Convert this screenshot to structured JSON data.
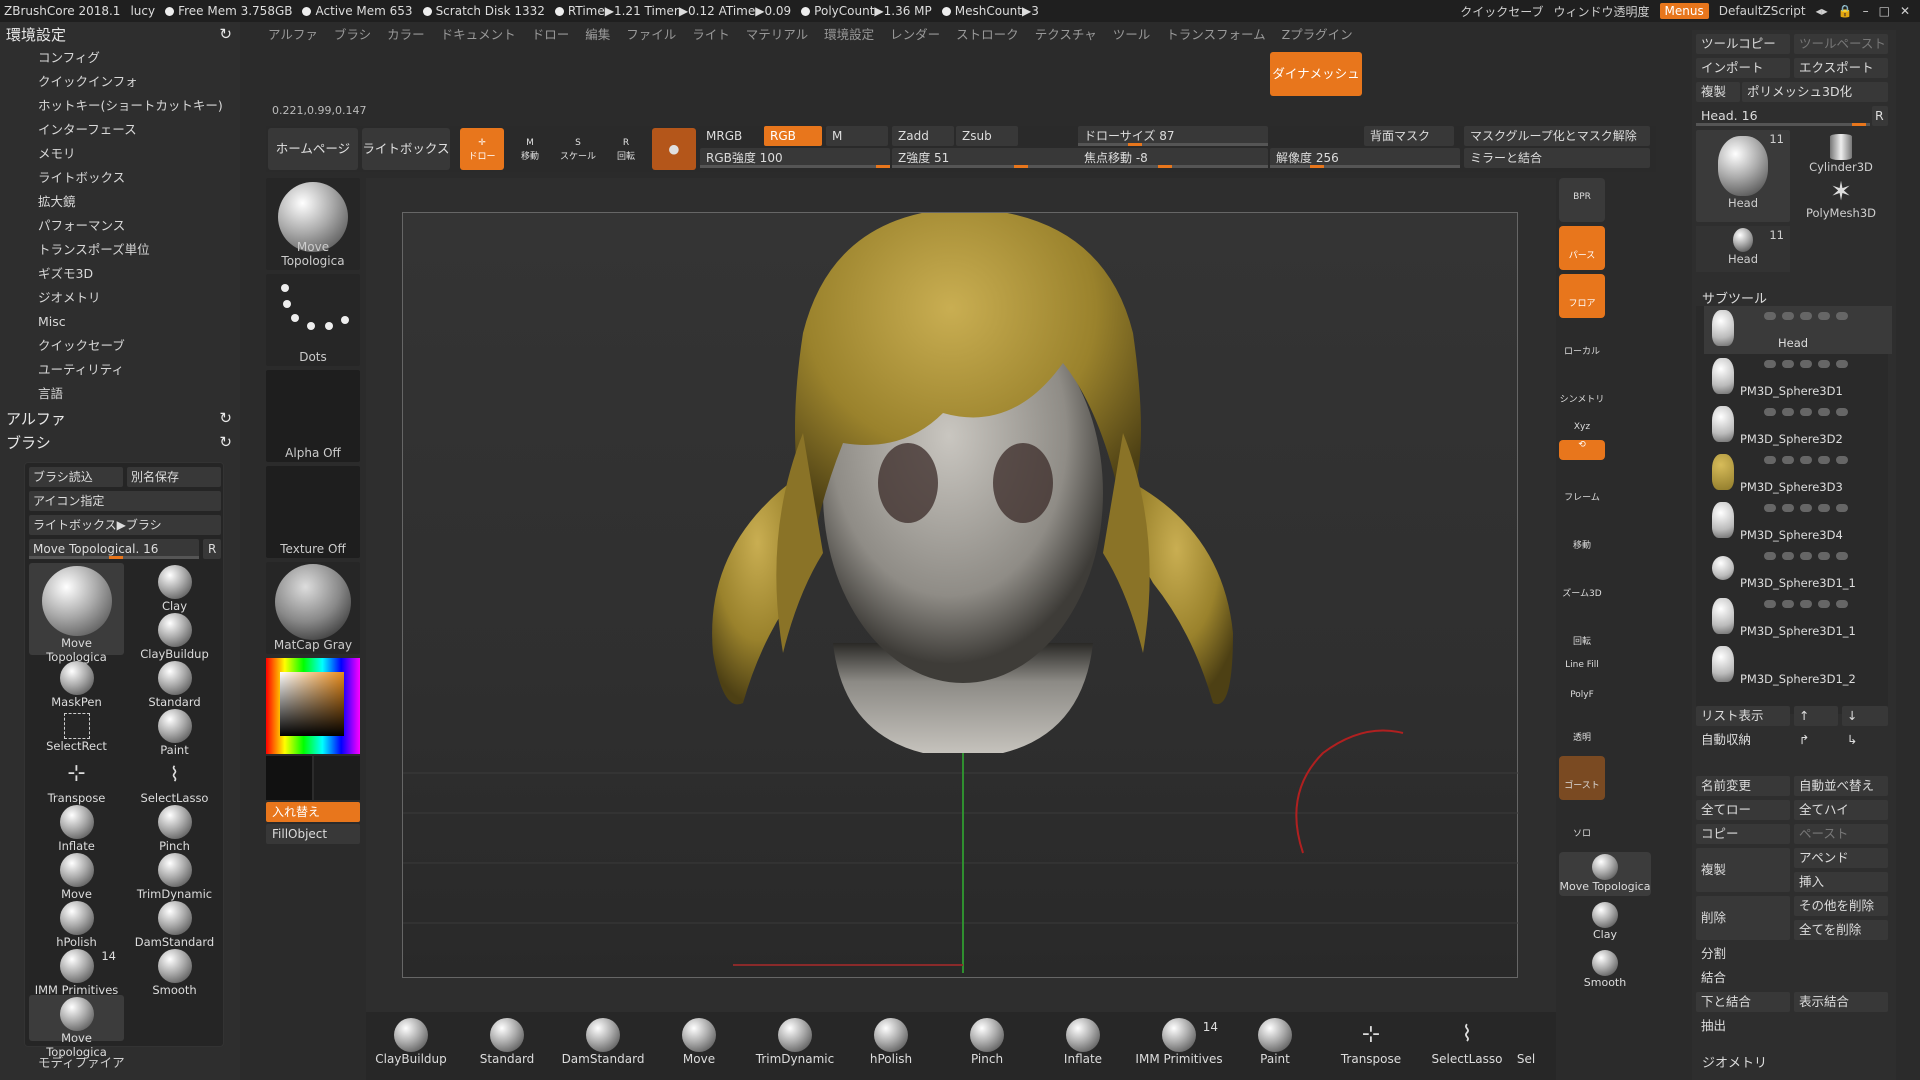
{
  "topbar": {
    "app": "ZBrushCore 2018.1",
    "user": "lucy",
    "free_mem": "Free Mem 3.758GB",
    "active_mem": "Active Mem 653",
    "scratch": "Scratch Disk 1332",
    "rtime": "RTime▶1.21 Timer▶0.12 ATime▶0.09",
    "polycount": "PolyCount▶1.36 MP",
    "meshcount": "MeshCount▶3",
    "quicksave": "クイックセーブ",
    "transparency": "ウィンドウ透明度",
    "menus": "Menus",
    "script": "DefaultZScript"
  },
  "left": {
    "env_title": "環境設定",
    "env_items": [
      "コンフィグ",
      "クイックインフォ",
      "ホットキー(ショートカットキー)",
      "インターフェース",
      "メモリ",
      "ライトボックス",
      "拡大鏡",
      "パフォーマンス",
      "トランスポーズ単位",
      "ギズモ3D",
      "ジオメトリ",
      "Misc",
      "クイックセーブ",
      "ユーティリティ",
      "言語"
    ],
    "alpha_title": "アルファ",
    "brush_title": "ブラシ",
    "load_brush": "ブラシ読込",
    "save_as": "別名保存",
    "icon_set": "アイコン指定",
    "lightbox_brush": "ライトボックス▶ブラシ",
    "current_brush": "Move Topological",
    "current_brush_size": "16",
    "r_label": "R",
    "brushes": [
      "Move Topologica",
      "Clay",
      "ClayBuildup",
      "MaskPen",
      "Standard",
      "SelectRect",
      "Paint",
      "Transpose",
      "SelectLasso",
      "Inflate",
      "Pinch",
      "Move",
      "TrimDynamic",
      "hPolish",
      "DamStandard",
      "IMM Primitives",
      "Smooth",
      "Move Topologica"
    ],
    "imm_count": "14",
    "modifier": "モディファイア"
  },
  "menubar": [
    "アルファ",
    "ブラシ",
    "カラー",
    "ドキュメント",
    "ドロー",
    "編集",
    "ファイル",
    "ライト",
    "マテリアル",
    "環境設定",
    "レンダー",
    "ストローク",
    "テクスチャ",
    "ツール",
    "トランスフォーム",
    "Zプラグイン"
  ],
  "dynamesh": "ダイナメッシュ",
  "coord": "0.221,0.99,0.147",
  "toolbar": {
    "home": "ホームページ",
    "lightbox": "ライトボックス",
    "draw": "ドロー",
    "move": "移動",
    "scale": "スケール",
    "rotate": "回転",
    "mrgb": "MRGB",
    "rgb": "RGB",
    "m": "M",
    "zadd": "Zadd",
    "zsub": "Zsub",
    "rgb_intensity": "RGB強度 100",
    "z_intensity": "Z強度 51",
    "draw_size": "ドローサイズ 87",
    "focal_shift": "焦点移動 -8",
    "resolution": "解像度 256",
    "backface_mask": "背面マスク",
    "mask_group": "マスクグループ化とマスク解除",
    "mirror_weld": "ミラーと結合"
  },
  "shelf": {
    "brush": "Move Topologica",
    "stroke": "Dots",
    "alpha": "Alpha Off",
    "texture": "Texture Off",
    "material": "MatCap Gray",
    "swap": "入れ替え",
    "fill": "FillObject"
  },
  "rightshelf": [
    "BPR",
    "パース",
    "フロア",
    "ローカル",
    "シンメトリ",
    "Xyz",
    "",
    "フレーム",
    "移動",
    "ズーム3D",
    "回転",
    "PolyF",
    "透明",
    "ゴースト",
    "ソロ"
  ],
  "rightshelf_brushes": [
    "Move Topologica",
    "Clay",
    "Smooth"
  ],
  "linefill": "Line Fill",
  "bottom": [
    "ClayBuildup",
    "Standard",
    "DamStandard",
    "Move",
    "TrimDynamic",
    "hPolish",
    "Pinch",
    "Inflate",
    "IMM Primitives",
    "Paint",
    "Transpose",
    "SelectLasso",
    "Sel"
  ],
  "bottom_imm_count": "14",
  "right": {
    "tool_copy": "ツールコピー",
    "tool_paste": "ツールペースト",
    "import": "インポート",
    "export": "エクスポート",
    "clone": "複製",
    "polymesh": "ポリメッシュ3D化",
    "head_label": "Head. 16",
    "r_label": "R",
    "tools": [
      {
        "name": "Head",
        "count": "11"
      },
      {
        "name": "Cylinder3D",
        "count": ""
      },
      {
        "name": "PolyMesh3D",
        "count": ""
      },
      {
        "name": "Head",
        "count": "11"
      }
    ],
    "subtool_title": "サブツール",
    "subtools": [
      "Head",
      "PM3D_Sphere3D1",
      "PM3D_Sphere3D2",
      "PM3D_Sphere3D3",
      "PM3D_Sphere3D4",
      "PM3D_Sphere3D1_1",
      "PM3D_Sphere3D1_1",
      "PM3D_Sphere3D1_2"
    ],
    "list_view": "リスト表示",
    "auto_collapse": "自動収納",
    "rename": "名前変更",
    "auto_reorder": "自動並べ替え",
    "all_low": "全てロー",
    "all_high": "全てハイ",
    "copy": "コピー",
    "paste": "ペースト",
    "append": "アペンド",
    "duplicate": "複製",
    "insert": "挿入",
    "delete": "削除",
    "delete_other": "その他を削除",
    "delete_all": "全てを削除",
    "split": "分割",
    "merge": "結合",
    "merge_down": "下と結合",
    "merge_visible": "表示結合",
    "extract": "抽出",
    "geometry": "ジオメトリ"
  },
  "colors": {
    "accent": "#e8761c",
    "panel": "#2e2e2e",
    "hair": "#a0892f"
  }
}
